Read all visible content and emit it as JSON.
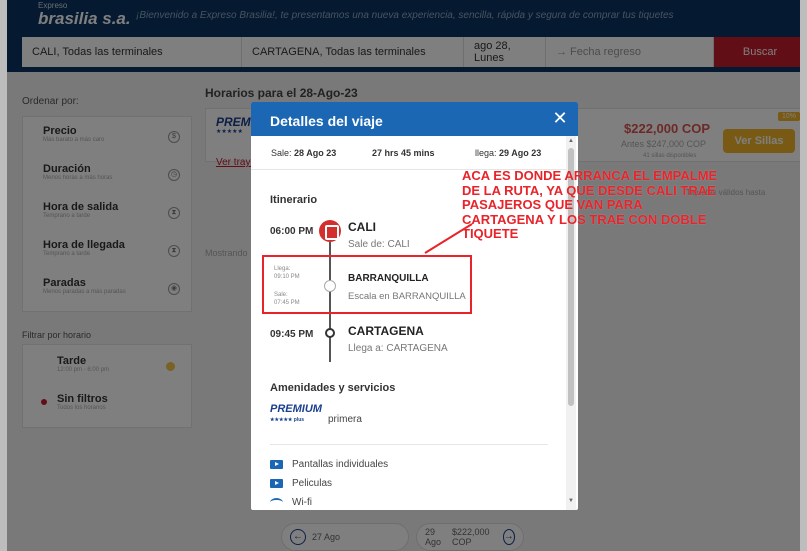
{
  "header": {
    "logo_small": "Expreso",
    "logo_main": "brasilia s.a.",
    "welcome": "¡Bienvenido a Expreso Brasilia!, te presentamos una nueva experiencia, sencilla, rápida y segura de comprar tus tiquetes"
  },
  "search": {
    "origin": "CALI, Todas las terminales",
    "destination": "CARTAGENA, Todas las terminales",
    "date": "ago 28, Lunes",
    "return_placeholder": "→  Fecha regreso",
    "button": "Buscar"
  },
  "sort": {
    "title": "Ordenar por:",
    "items": [
      {
        "label": "Precio",
        "sub": "Más barato a más caro",
        "icon": "dollar-icon"
      },
      {
        "label": "Duración",
        "sub": "Menos horas a más horas",
        "icon": "clock-icon"
      },
      {
        "label": "Hora de salida",
        "sub": "Temprano a tarde",
        "icon": "hourglass-icon"
      },
      {
        "label": "Hora de llegada",
        "sub": "Temprano a tarde",
        "icon": "hourglass-icon"
      },
      {
        "label": "Paradas",
        "sub": "Menos paradas a más paradas",
        "icon": "stops-icon"
      }
    ]
  },
  "filter": {
    "title": "Filtrar por horario",
    "items": [
      {
        "label": "Tarde",
        "sub": "12:00 pm - 6:00 pm"
      },
      {
        "label": "Sin filtros",
        "sub": "Todos los horarios"
      }
    ]
  },
  "results": {
    "title": "Horarios para el 28-Ago-23",
    "card": {
      "brand": "PREMIUM",
      "stars": "★★★★★",
      "link": "Ver trayecto",
      "price": "$222,000 COP",
      "old_price": "Antes $247,000 COP",
      "seats": "41 sillas disponibles",
      "button": "Ver Sillas",
      "badge": "10%",
      "extra": "Tiquetes válidos hasta"
    },
    "mostrando": "Mostrando"
  },
  "date_nav": {
    "prev": "27 Ago",
    "next_date": "29 Ago",
    "next_price": "$222,000 COP"
  },
  "modal": {
    "title": "Detalles del viaje",
    "close": "✕",
    "sale_label": "Sale: ",
    "sale_date": "28 Ago 23",
    "duration": "27 hrs 45 mins",
    "llega_label": "llega: ",
    "llega_date": "29 Ago 23",
    "itinerary_title": "Itinerario",
    "stops": [
      {
        "time": "06:00 PM",
        "city": "CALI",
        "sub": "Sale de: CALI"
      },
      {
        "arrive_label": "Llega:",
        "arrive_time": "09:10 PM",
        "depart_label": "Sale:",
        "depart_time": "07:45 PM",
        "city": "BARRANQUILLA",
        "sub": "Escala en BARRANQUILLA"
      },
      {
        "time": "09:45 PM",
        "city": "CARTAGENA",
        "sub": "Llega a: CARTAGENA"
      }
    ],
    "amenities_title": "Amenidades y servicios",
    "premium_logo": "PREMIUM",
    "premium_plus": "★★★★★ plus",
    "premium_class": "primera",
    "services": [
      {
        "icon": "tv-icon",
        "label": "Pantallas individuales"
      },
      {
        "icon": "tv-icon",
        "label": "Peliculas"
      },
      {
        "icon": "wifi-icon",
        "label": "Wi-fi"
      }
    ]
  },
  "annotation": {
    "text": "ACA ES DONDE ARRANCA EL EMPALME DE LA RUTA, YA QUE DESDE CALI TRAE PASAJEROS QUE VAN PARA CARTAGENA Y LOS TRAE CON DOBLE TIQUETE",
    "color": "#e8232a"
  },
  "colors": {
    "header": "#0b3360",
    "modal_header": "#1b67b4",
    "search_button": "#c41c2c",
    "price": "#d9534f",
    "seats_button": "#f0b429"
  }
}
